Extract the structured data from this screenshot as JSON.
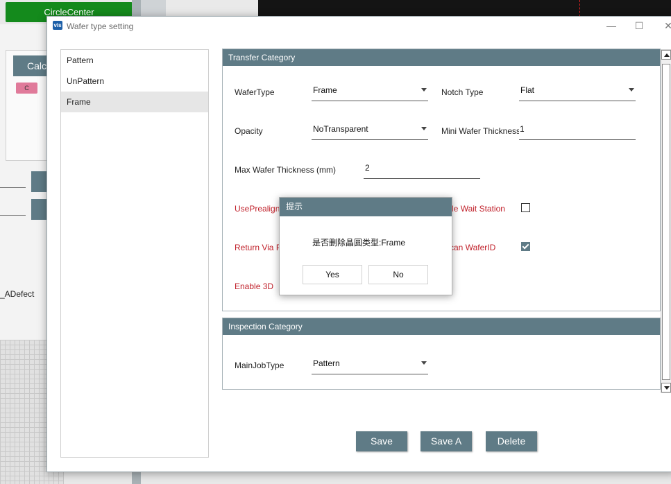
{
  "background": {
    "circle_center_label": "CircleCenter",
    "calc_label": "Calc",
    "pink_label": "C",
    "adefect_label": "_ADefect",
    "accent_color": "#5f7b86",
    "green_color": "#148a1c"
  },
  "window": {
    "title": "Wafer type setting",
    "icon_text": "vis",
    "minimize": "—",
    "maximize": "☐",
    "close": "✕"
  },
  "wafer_types": [
    "Pattern",
    "UnPattern",
    "Frame"
  ],
  "selected_type": "Frame",
  "transfer": {
    "header": "Transfer Category",
    "wafer_type_label": "WaferType",
    "wafer_type_value": "Frame",
    "notch_type_label": "Notch Type",
    "notch_type_value": "Flat",
    "opacity_label": "Opacity",
    "opacity_value": "NoTransparent",
    "mini_thickness_label": "Mini Wafer Thickness",
    "mini_thickness_value": "1",
    "max_thickness_label": "Max Wafer Thickness (mm)",
    "max_thickness_value": "2",
    "use_prealigner_label": "UsePrealigner",
    "enable_wait_station_label": "Enable Wait Station",
    "enable_wait_station_checked": false,
    "return_via_label": "Return Via P",
    "scan_waferid_label": "Scan WaferID",
    "scan_waferid_checked": true,
    "enable_3d_label": "Enable 3D"
  },
  "inspection": {
    "header": "Inspection Category",
    "main_job_type_label": "MainJobType",
    "main_job_type_value": "Pattern"
  },
  "buttons": {
    "save": "Save",
    "save_as": "Save A",
    "delete": "Delete"
  },
  "message_box": {
    "title": "提示",
    "text": "是否删除晶圆类型:Frame",
    "yes": "Yes",
    "no": "No"
  }
}
